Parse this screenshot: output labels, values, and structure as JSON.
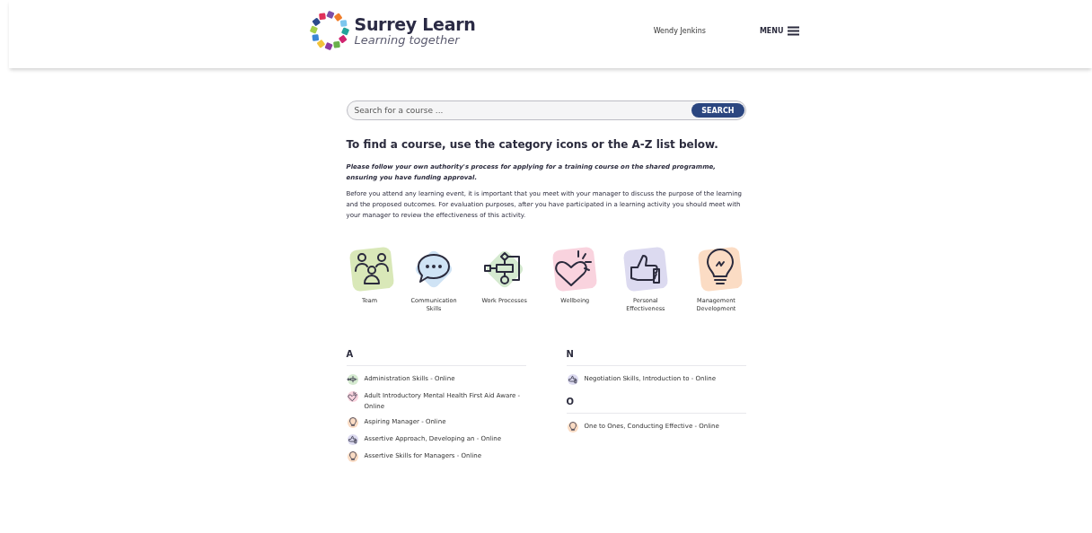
{
  "header": {
    "logo_title": "Surrey Learn",
    "logo_tagline": "Learning together",
    "user_name": "Wendy Jenkins",
    "menu_label": "MENU"
  },
  "search": {
    "placeholder": "Search for a course ...",
    "button": "SEARCH"
  },
  "heading": "To find a course, use the category icons or the A-Z list below.",
  "notice": "Please follow your own authority's process for applying for a training course on the shared programme, ensuring you have funding approval.",
  "intro": "Before you attend any learning event, it is important that you meet with your manager to discuss the purpose of the learning and the proposed outcomes. For evaluation purposes, after you have participated in a learning activity you should meet with your manager to review the effectiveness of this activity.",
  "categories": [
    {
      "kind": "team",
      "label": "Team",
      "color": "#d9e8b8"
    },
    {
      "kind": "communication",
      "label": "Communication Skills",
      "color": "#cfe3f5"
    },
    {
      "kind": "process",
      "label": "Work Processes",
      "color": "#d5ead0"
    },
    {
      "kind": "wellbeing",
      "label": "Wellbeing",
      "color": "#f9d3de"
    },
    {
      "kind": "personal",
      "label": "Personal Effectiveness",
      "color": "#dcdaf0"
    },
    {
      "kind": "management",
      "label": "Management Development",
      "color": "#fbdcc4"
    }
  ],
  "az_columns": [
    {
      "groups": [
        {
          "letter": "A",
          "courses": [
            {
              "kind": "process",
              "title": "Administration Skills - Online"
            },
            {
              "kind": "wellbeing",
              "title": "Adult Introductory Mental Health First Aid Aware - Online"
            },
            {
              "kind": "management",
              "title": "Aspiring Manager - Online"
            },
            {
              "kind": "personal",
              "title": "Assertive Approach, Developing an - Online"
            },
            {
              "kind": "management",
              "title": "Assertive Skills for Managers - Online"
            }
          ]
        }
      ]
    },
    {
      "groups": [
        {
          "letter": "N",
          "courses": [
            {
              "kind": "personal",
              "title": "Negotiation Skills, Introduction to - Online"
            }
          ]
        },
        {
          "letter": "O",
          "courses": [
            {
              "kind": "management",
              "title": "One to Ones, Conducting Effective - Online"
            }
          ]
        }
      ]
    }
  ]
}
